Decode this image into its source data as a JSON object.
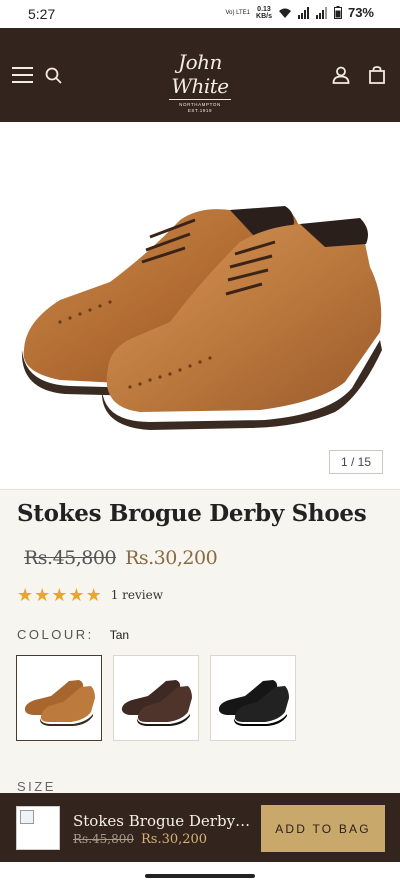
{
  "status_bar": {
    "time": "5:27",
    "volte": "Vo) LTE1",
    "net_speed_value": "0.13",
    "net_speed_unit": "KB/s",
    "battery": "73%"
  },
  "header": {
    "brand_script": "John White",
    "brand_location": "NORTHAMPTON",
    "brand_est": "EST.1919",
    "icons": [
      "menu-icon",
      "search-icon",
      "account-icon",
      "bag-icon"
    ],
    "background": "#33241e"
  },
  "gallery": {
    "counter": "1 / 15"
  },
  "product": {
    "title": "Stokes Brogue Derby Shoes",
    "price_original": "Rs.45,800",
    "price_sale": "Rs.30,200",
    "rating_stars": 5,
    "review_text": "1 review",
    "colour_label": "COLOUR:",
    "colour_value": "Tan",
    "swatches": [
      {
        "name": "Tan",
        "selected": true,
        "color": "#b06a32"
      },
      {
        "name": "Brown",
        "selected": false,
        "color": "#4a2e22"
      },
      {
        "name": "Black",
        "selected": false,
        "color": "#151515"
      }
    ],
    "size_label": "SIZE"
  },
  "sticky_bar": {
    "title": "Stokes Brogue Derby S...",
    "price_original": "Rs.45,800",
    "price_sale": "Rs.30,200",
    "button_label": "ADD TO BAG"
  },
  "colors": {
    "accent_gold": "#c8a96b",
    "price_sale": "#8a6a3e",
    "star": "#e9a62c"
  }
}
